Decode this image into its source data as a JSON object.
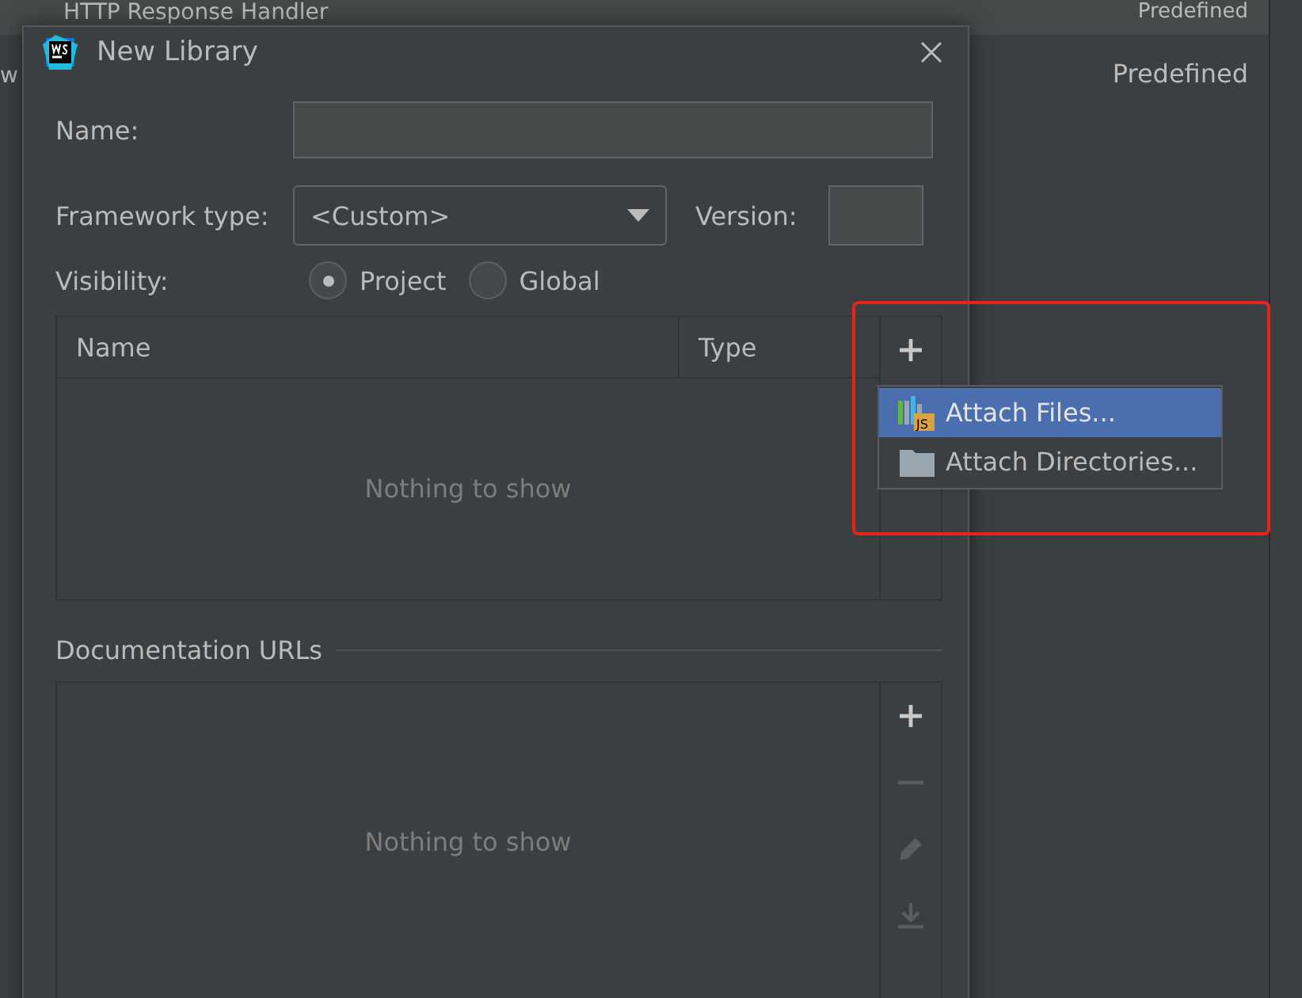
{
  "background": {
    "rows": [
      {
        "name": "HTTP Response Handler",
        "type": "Predefined"
      },
      {
        "name": "w",
        "type": "Predefined"
      }
    ]
  },
  "dialog": {
    "title": "New Library",
    "name_field": {
      "label": "Name:"
    },
    "framework": {
      "label": "Framework type:",
      "value": "<Custom>"
    },
    "version": {
      "label": "Version:"
    },
    "visibility": {
      "label": "Visibility:",
      "options": [
        {
          "label": "Project",
          "selected": true
        },
        {
          "label": "Global",
          "selected": false
        }
      ]
    },
    "classes_table": {
      "columns": [
        "Name",
        "Type"
      ],
      "empty_text": "Nothing to show",
      "toolbar": [
        {
          "kind": "add"
        }
      ]
    },
    "attach_menu": {
      "items": [
        {
          "kind": "files",
          "label": "Attach Files...",
          "badge": "JS",
          "selected": true
        },
        {
          "kind": "directories",
          "label": "Attach Directories...",
          "selected": false
        }
      ]
    },
    "documentation": {
      "label": "Documentation URLs",
      "empty_text": "Nothing to show",
      "toolbar": [
        {
          "kind": "add",
          "disabled": false
        },
        {
          "kind": "remove",
          "disabled": true
        },
        {
          "kind": "edit",
          "disabled": true
        },
        {
          "kind": "download",
          "disabled": true
        }
      ]
    }
  }
}
